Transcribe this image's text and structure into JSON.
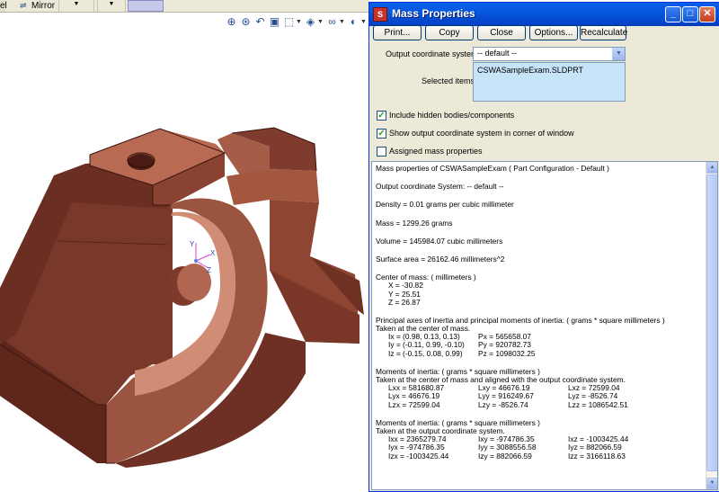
{
  "cad": {
    "toolbar": {
      "left_label": "el",
      "mirror_label": "Mirror"
    },
    "icons": [
      "zoom-to-fit-icon",
      "zoom-area-icon",
      "previous-view-icon",
      "section-view-icon",
      "view-orientation-icon",
      "display-style-icon",
      "hide-show-icon",
      "appearance-icon"
    ],
    "triad": {
      "x": "X",
      "y": "Y",
      "z": "Z"
    },
    "colors": {
      "part_dark": "#6f3122",
      "part_mid": "#98503d",
      "part_light": "#b86a53",
      "accent_blue": "#0a5ee8"
    }
  },
  "dialog": {
    "title": "Mass Properties",
    "buttons": {
      "print": "Print...",
      "copy": "Copy",
      "close": "Close",
      "options": "Options...",
      "recalculate": "Recalculate"
    },
    "coord_label": "Output coordinate system:",
    "coord_value": "-- default --",
    "selected_label": "Selected items:",
    "selected_items": [
      "CSWASampleExam.SLDPRT"
    ],
    "checkboxes": [
      {
        "label": "Include hidden bodies/components",
        "checked": true,
        "mark": "✓"
      },
      {
        "label": "Show output coordinate system in corner of window",
        "checked": true,
        "mark": "✓"
      },
      {
        "label": "Assigned mass properties",
        "checked": false,
        "mark": ""
      }
    ],
    "results": {
      "header": "Mass properties of CSWASampleExam ( Part Configuration - Default )",
      "output_cs": "Output  coordinate System: -- default --",
      "density": "Density = 0.01 grams per cubic millimeter",
      "mass": "Mass = 1299.26 grams",
      "volume": "Volume = 145984.07 cubic millimeters",
      "surface_area": "Surface area = 26162.46 millimeters^2",
      "com_title": "Center of mass: ( millimeters )",
      "com_x": "X = -30.82",
      "com_y": "Y = 25.51",
      "com_z": "Z = 26.87",
      "principal_title": "Principal axes of inertia and principal moments of inertia: ( grams * square millimeters )",
      "principal_taken": "Taken at the center of mass.",
      "principal_rows": [
        [
          "Ix = (0.98, 0.13, 0.13)",
          "Px = 565658.07"
        ],
        [
          "Iy = (-0.11, 0.99, -0.10)",
          "Py = 920782.73"
        ],
        [
          "Iz = (-0.15, 0.08, 0.99)",
          "Pz = 1098032.25"
        ]
      ],
      "moi_com_title": "Moments of inertia: ( grams * square millimeters )",
      "moi_com_taken": "Taken at the center of mass and aligned with the output coordinate system.",
      "moi_com_rows": [
        [
          "Lxx = 581680.87",
          "Lxy = 46676.19",
          "Lxz = 72599.04"
        ],
        [
          "Lyx = 46676.19",
          "Lyy = 916249.67",
          "Lyz = -8526.74"
        ],
        [
          "Lzx = 72599.04",
          "Lzy = -8526.74",
          "Lzz = 1086542.51"
        ]
      ],
      "moi_out_title": "Moments of inertia: ( grams * square millimeters )",
      "moi_out_taken": "Taken at the output coordinate system.",
      "moi_out_rows": [
        [
          "Ixx = 2365279.74",
          "Ixy = -974786.35",
          "Ixz = -1003425.44"
        ],
        [
          "Iyx = -974786.35",
          "Iyy = 3088556.58",
          "Iyz = 882066.59"
        ],
        [
          "Izx = -1003425.44",
          "Izy = 882066.59",
          "Izz = 3166118.63"
        ]
      ]
    }
  }
}
